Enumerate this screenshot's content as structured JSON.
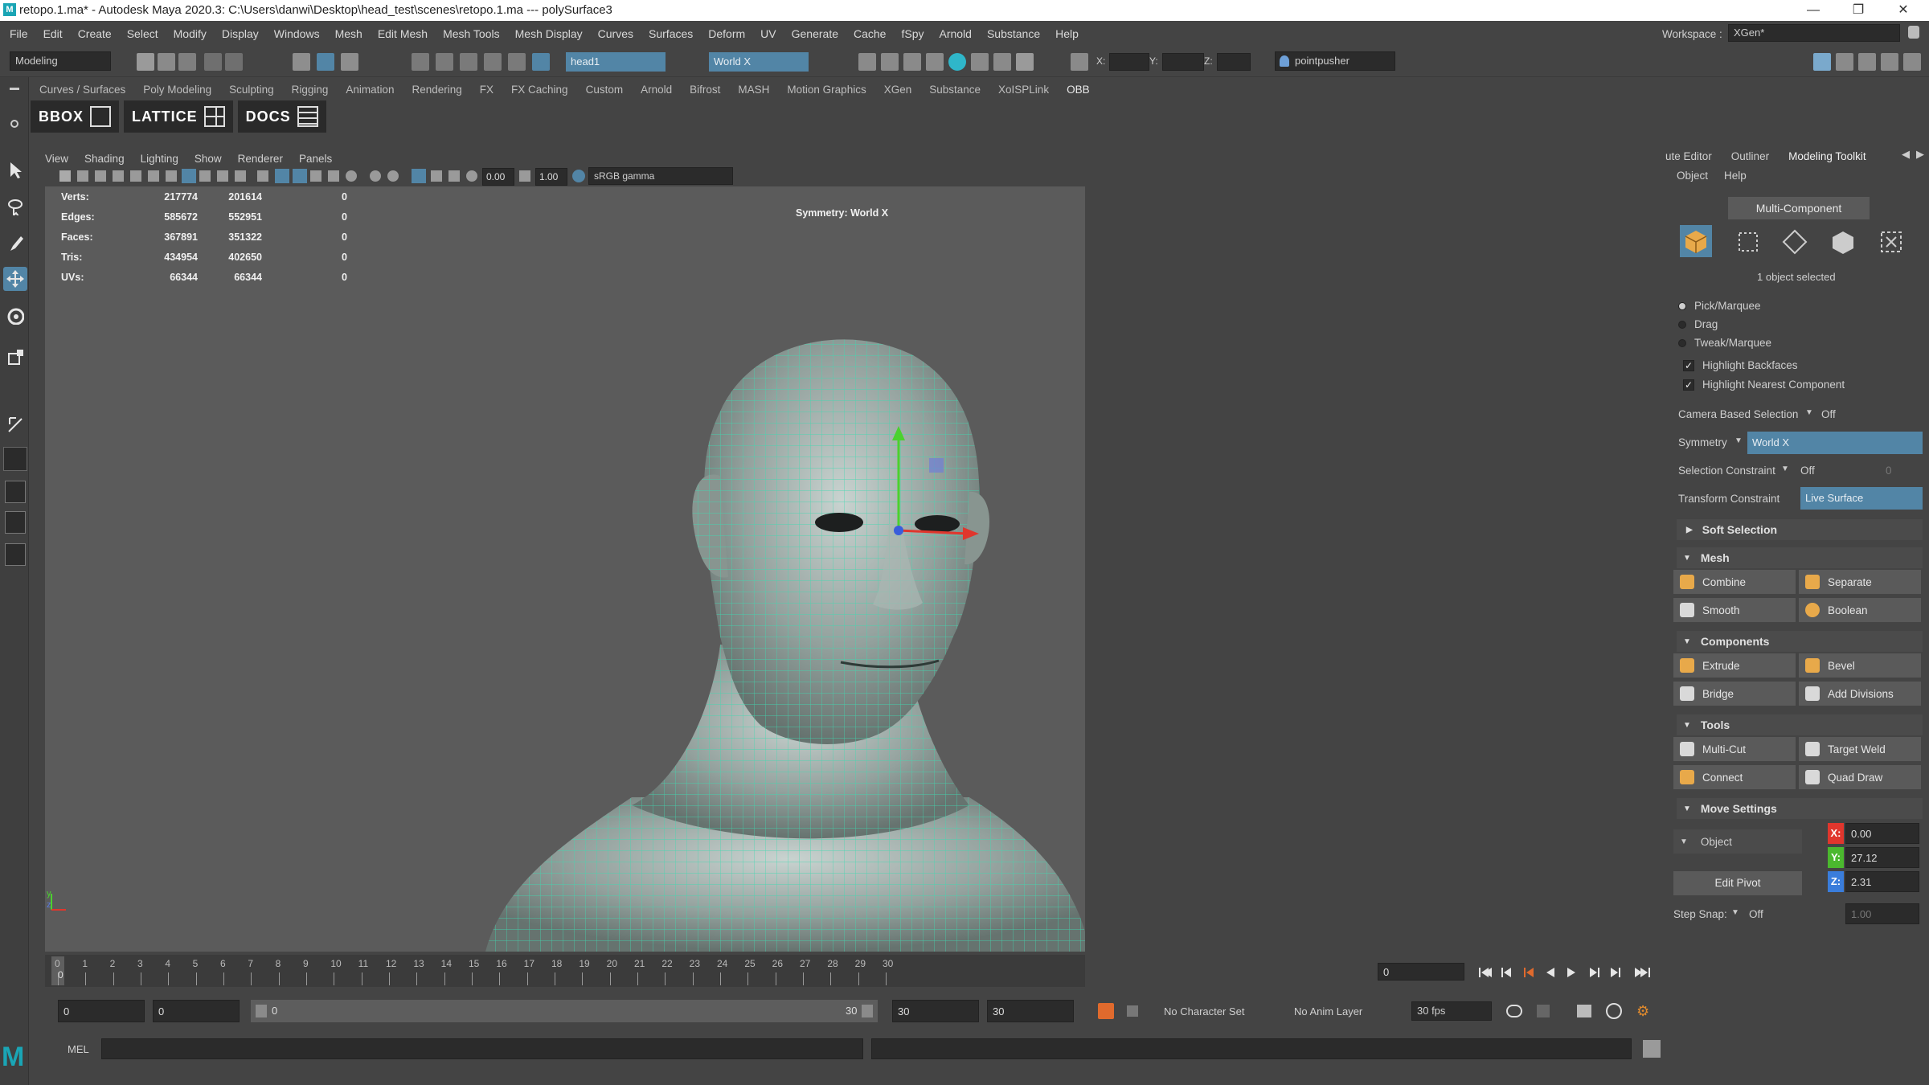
{
  "window": {
    "title": "retopo.1.ma* - Autodesk Maya 2020.3: C:\\Users\\danwi\\Desktop\\head_test\\scenes\\retopo.1.ma   ---   polySurface3",
    "logo": "M"
  },
  "menubar": {
    "items": [
      "File",
      "Edit",
      "Create",
      "Select",
      "Modify",
      "Display",
      "Windows",
      "Mesh",
      "Edit Mesh",
      "Mesh Tools",
      "Mesh Display",
      "Curves",
      "Surfaces",
      "Deform",
      "UV",
      "Generate",
      "Cache",
      "fSpy",
      "Arnold",
      "Substance",
      "Help"
    ],
    "workspace_label": "Workspace :",
    "workspace_value": "XGen*"
  },
  "statusline": {
    "menuset": "Modeling",
    "object_name": "head1",
    "symmetry": "World X",
    "x_label": "X:",
    "y_label": "Y:",
    "z_label": "Z:",
    "user": "pointpusher"
  },
  "shelf": {
    "tabs": [
      "Curves / Surfaces",
      "Poly Modeling",
      "Sculpting",
      "Rigging",
      "Animation",
      "Rendering",
      "FX",
      "FX Caching",
      "Custom",
      "Arnold",
      "Bifrost",
      "MASH",
      "Motion Graphics",
      "XGen",
      "Substance",
      "XoISPLink",
      "OBB"
    ],
    "active_tab": "OBB",
    "buttons": [
      "BBOX",
      "LATTICE",
      "DOCS"
    ]
  },
  "viewport": {
    "menu": [
      "View",
      "Shading",
      "Lighting",
      "Show",
      "Renderer",
      "Panels"
    ],
    "exposure": "0.00",
    "gamma": "1.00",
    "colorspace": "sRGB gamma",
    "symmetry_hud": "Symmetry: World X",
    "stats": [
      {
        "label": "Verts:",
        "a": "217774",
        "b": "201614",
        "c": "0"
      },
      {
        "label": "Edges:",
        "a": "585672",
        "b": "552951",
        "c": "0"
      },
      {
        "label": "Faces:",
        "a": "367891",
        "b": "351322",
        "c": "0"
      },
      {
        "label": "Tris:",
        "a": "434954",
        "b": "402650",
        "c": "0"
      },
      {
        "label": "UVs:",
        "a": "66344",
        "b": "66344",
        "c": "0"
      }
    ],
    "axis_y": "y",
    "axis_z": "z"
  },
  "timeline": {
    "ticks": [
      "0",
      "1",
      "2",
      "3",
      "4",
      "5",
      "6",
      "7",
      "8",
      "9",
      "10",
      "11",
      "12",
      "13",
      "14",
      "15",
      "16",
      "17",
      "18",
      "19",
      "20",
      "21",
      "22",
      "23",
      "24",
      "25",
      "26",
      "27",
      "28",
      "29",
      "30"
    ],
    "current_frame": "0",
    "current_field": "0"
  },
  "range": {
    "start": "0",
    "anim_start": "0",
    "slider_start": "0",
    "slider_end": "30",
    "anim_end": "30",
    "end": "30",
    "character_set": "No Character Set",
    "anim_layer": "No Anim Layer",
    "fps": "30 fps"
  },
  "cmdline": {
    "label": "MEL"
  },
  "rpanel": {
    "tabs": [
      "ute Editor",
      "Outliner",
      "Modeling Toolkit"
    ],
    "menu": [
      "Object",
      "Help"
    ],
    "mode_button": "Multi-Component",
    "selection_status": "1 object selected",
    "pick_modes": [
      "Pick/Marquee",
      "Drag",
      "Tweak/Marquee"
    ],
    "checks": [
      "Highlight Backfaces",
      "Highlight Nearest Component"
    ],
    "camera_based_label": "Camera Based Selection",
    "camera_based_value": "Off",
    "symmetry_label": "Symmetry",
    "symmetry_value": "World X",
    "sel_constraint_label": "Selection Constraint",
    "sel_constraint_value": "Off",
    "sel_constraint_num": "0",
    "transform_constraint_label": "Transform Constraint",
    "transform_constraint_value": "Live Surface",
    "soft_selection": "Soft Selection",
    "mesh_section": "Mesh",
    "mesh_buttons": [
      "Combine",
      "Separate",
      "Smooth",
      "Boolean"
    ],
    "components_section": "Components",
    "component_buttons": [
      "Extrude",
      "Bevel",
      "Bridge",
      "Add Divisions"
    ],
    "tools_section": "Tools",
    "tool_buttons": [
      "Multi-Cut",
      "Target Weld",
      "Connect",
      "Quad Draw"
    ],
    "move_section": "Move Settings",
    "move_space": "Object",
    "edit_pivot": "Edit Pivot",
    "x_val": "0.00",
    "y_val": "27.12",
    "z_val": "2.31",
    "step_snap_label": "Step Snap:",
    "step_snap_value": "Off",
    "step_snap_num": "1.00"
  },
  "colors": {
    "accent_blue": "#5285a6",
    "wire": "#3fd9b0",
    "x_axis": "#e0362d",
    "y_axis": "#4bd12e",
    "z_axis": "#3a5ddb"
  }
}
